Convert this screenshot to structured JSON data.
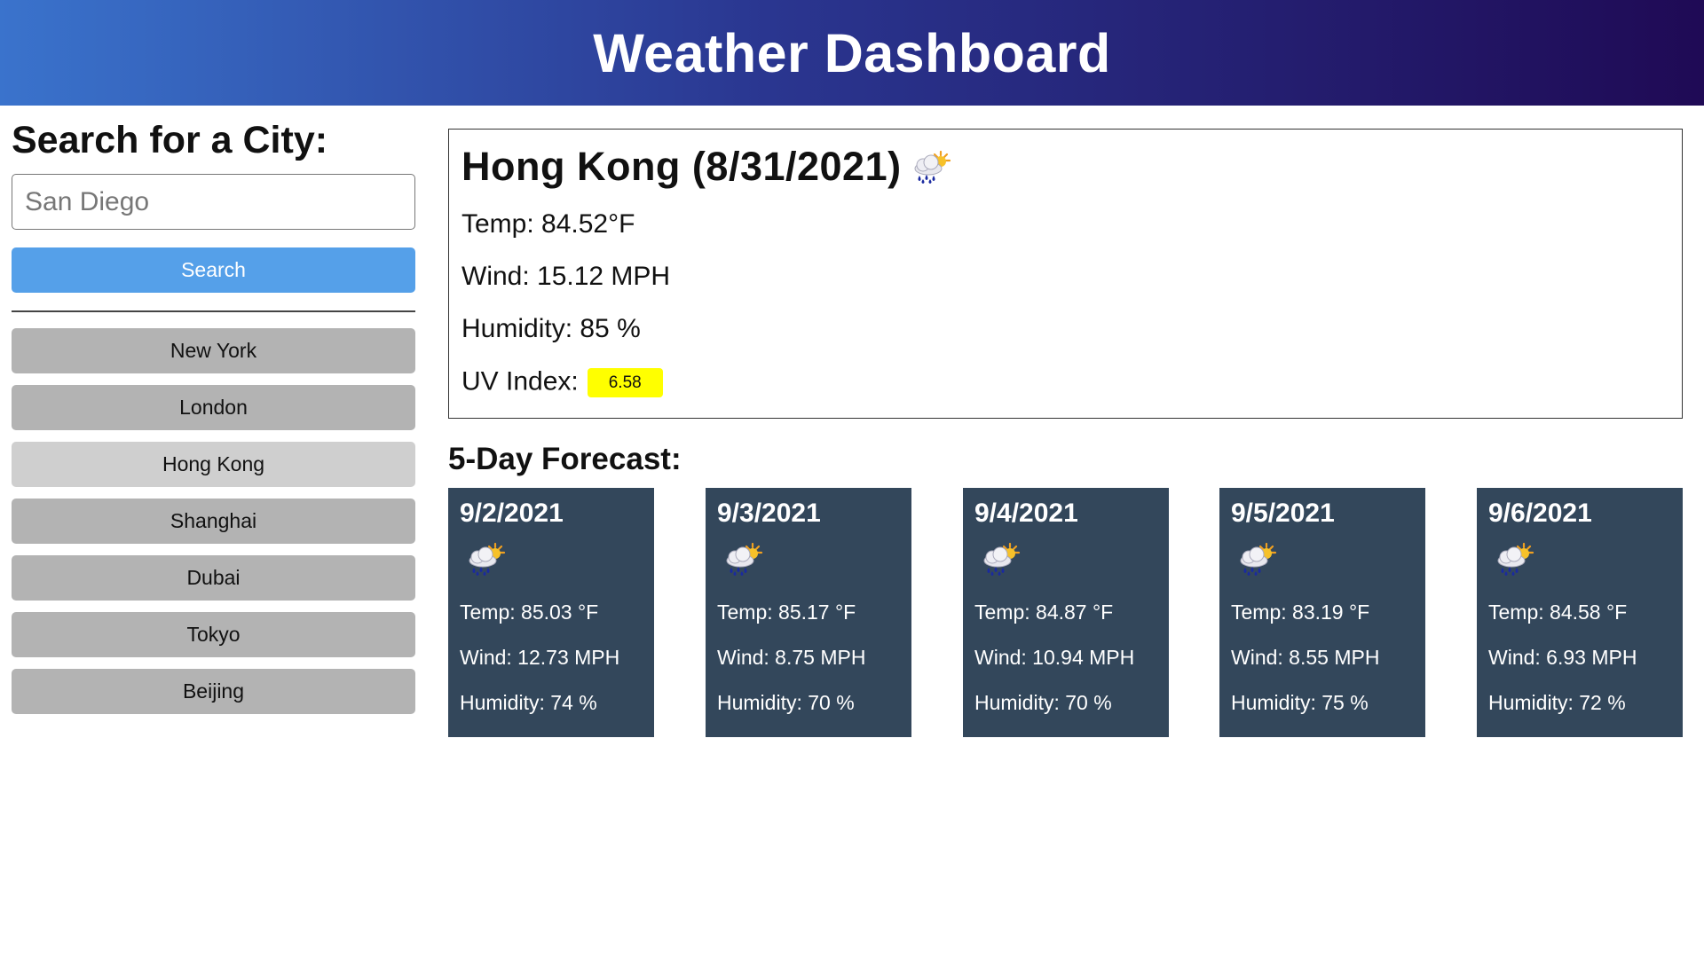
{
  "header": {
    "title": "Weather Dashboard"
  },
  "search": {
    "heading": "Search for a City:",
    "input_value": "",
    "placeholder": "San Diego",
    "button_label": "Search"
  },
  "history": {
    "cities": [
      {
        "label": "New York",
        "active": false
      },
      {
        "label": "London",
        "active": false
      },
      {
        "label": "Hong Kong",
        "active": true
      },
      {
        "label": "Shanghai",
        "active": false
      },
      {
        "label": "Dubai",
        "active": false
      },
      {
        "label": "Tokyo",
        "active": false
      },
      {
        "label": "Beijing",
        "active": false
      }
    ]
  },
  "current": {
    "title": "Hong Kong (8/31/2021)",
    "icon": "rain-sun-cloud-icon",
    "temp": "Temp: 84.52°F",
    "wind": "Wind: 15.12 MPH",
    "humidity": "Humidity: 85 %",
    "uv_label": "UV Index:",
    "uv_value": "6.58",
    "uv_color": "#ffff00"
  },
  "forecast": {
    "heading": "5-Day Forecast:",
    "days": [
      {
        "date": "9/2/2021",
        "icon": "rain-sun-cloud-icon",
        "temp": "Temp: 85.03 °F",
        "wind": "Wind: 12.73 MPH",
        "humidity": "Humidity: 74 %"
      },
      {
        "date": "9/3/2021",
        "icon": "rain-sun-cloud-icon",
        "temp": "Temp: 85.17 °F",
        "wind": "Wind: 8.75 MPH",
        "humidity": "Humidity: 70 %"
      },
      {
        "date": "9/4/2021",
        "icon": "rain-sun-cloud-icon",
        "temp": "Temp: 84.87 °F",
        "wind": "Wind: 10.94 MPH",
        "humidity": "Humidity: 70 %"
      },
      {
        "date": "9/5/2021",
        "icon": "rain-sun-cloud-icon",
        "temp": "Temp: 83.19 °F",
        "wind": "Wind: 8.55 MPH",
        "humidity": "Humidity: 75 %"
      },
      {
        "date": "9/6/2021",
        "icon": "rain-sun-cloud-icon",
        "temp": "Temp: 84.58 °F",
        "wind": "Wind: 6.93 MPH",
        "humidity": "Humidity: 72 %"
      }
    ]
  },
  "colors": {
    "header_gradient_start": "#3a73cc",
    "header_gradient_end": "#1f0a55",
    "search_button": "#55a0e9",
    "city_button": "#b3b3b3",
    "city_button_active": "#cfcfcf",
    "forecast_card": "#33475b"
  }
}
